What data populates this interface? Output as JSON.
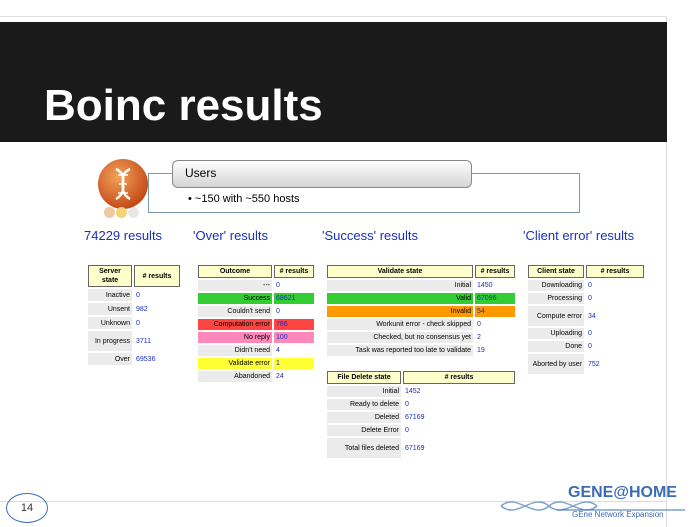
{
  "slide": {
    "title": "Boinc results",
    "page_number": "14"
  },
  "users": {
    "heading": "Users",
    "bullet": "~150 with ~550 hosts"
  },
  "sections": {
    "total": "74229 results",
    "over": "'Over' results",
    "success": "'Success' results",
    "client_error": "'Client error' results"
  },
  "server_state_table": {
    "headers": [
      "Server state",
      "# results"
    ],
    "rows": [
      {
        "label": "Inactive",
        "value": "0"
      },
      {
        "label": "Unsent",
        "value": "982"
      },
      {
        "label": "Unknown",
        "value": "0"
      },
      {
        "label": "In progress",
        "value": "3711"
      },
      {
        "label": "Over",
        "value": "69536"
      }
    ]
  },
  "outcome_table": {
    "headers": [
      "Outcome",
      "# results"
    ],
    "rows": [
      {
        "label": "---",
        "value": "0",
        "color": ""
      },
      {
        "label": "Success",
        "value": "68621",
        "color": "green"
      },
      {
        "label": "Couldn't send",
        "value": "0",
        "color": ""
      },
      {
        "label": "Computation error",
        "value": "786",
        "color": "red"
      },
      {
        "label": "No reply",
        "value": "100",
        "color": "pink"
      },
      {
        "label": "Didn't need",
        "value": "4",
        "color": ""
      },
      {
        "label": "Validate error",
        "value": "1",
        "color": "yellow"
      },
      {
        "label": "Abandoned",
        "value": "24",
        "color": ""
      }
    ]
  },
  "validate_table": {
    "headers": [
      "Validate state",
      "# results"
    ],
    "rows": [
      {
        "label": "Initial",
        "value": "1450",
        "color": ""
      },
      {
        "label": "Valid",
        "value": "67096",
        "color": "green"
      },
      {
        "label": "Invalid",
        "value": "54",
        "color": "orange"
      },
      {
        "label": "Workunit error - check skipped",
        "value": "0",
        "color": ""
      },
      {
        "label": "Checked, but no consensus yet",
        "value": "2",
        "color": ""
      },
      {
        "label": "Task was reported too late to validate",
        "value": "19",
        "color": ""
      }
    ]
  },
  "file_delete_table": {
    "headers": [
      "File Delete state",
      "# results"
    ],
    "rows": [
      {
        "label": "Initial",
        "value": "1452"
      },
      {
        "label": "Ready to delete",
        "value": "0"
      },
      {
        "label": "Deleted",
        "value": "67169"
      },
      {
        "label": "Delete Error",
        "value": "0"
      },
      {
        "label": "Total files deleted",
        "value": "67169"
      }
    ]
  },
  "client_state_table": {
    "headers": [
      "Client state",
      "# results"
    ],
    "rows": [
      {
        "label": "Downloading",
        "value": "0"
      },
      {
        "label": "Processing",
        "value": "0"
      },
      {
        "label": "Compute error",
        "value": "34"
      },
      {
        "label": "Uploading",
        "value": "0"
      },
      {
        "label": "Done",
        "value": "0"
      },
      {
        "label": "Aborted by user",
        "value": "752"
      }
    ]
  },
  "footer": {
    "brand": "GENE@HOME",
    "tagline": "GEne Network Expansion"
  },
  "colors": {
    "banner": "#1a1a1a",
    "link_blue": "#1a2fbf",
    "header_yellow": "#ffffcc",
    "green": "#33cc33",
    "red": "#ff4444",
    "pink": "#ff88bb",
    "yellow": "#ffff33",
    "orange": "#ff9900"
  }
}
